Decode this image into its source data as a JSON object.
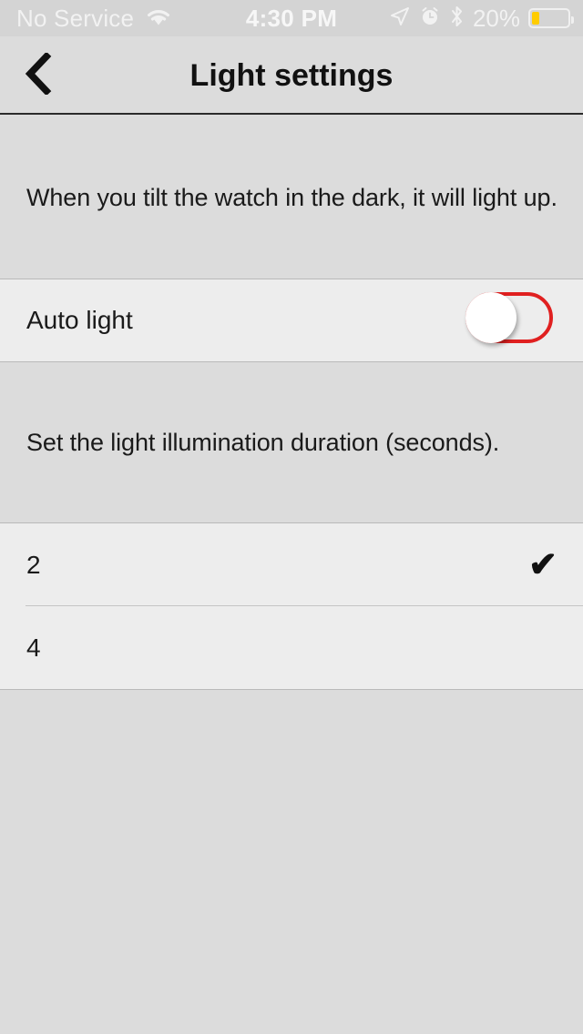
{
  "status_bar": {
    "carrier": "No Service",
    "wifi_icon": "wifi-icon",
    "time": "4:30 PM",
    "location_icon": "location-arrow-icon",
    "alarm_icon": "alarm-clock-icon",
    "bluetooth_icon": "bluetooth-icon",
    "battery_percent": "20%",
    "battery_level": 20,
    "battery_color": "#ffcc00"
  },
  "nav_bar": {
    "back_icon": "chevron-left-icon",
    "title": "Light settings"
  },
  "sections": {
    "auto_light": {
      "description": "When you tilt the watch in the dark, it will light up.",
      "row_label": "Auto light",
      "toggle_state": "off",
      "toggle_color": "#e02020"
    },
    "duration": {
      "description": "Set the light illumination duration (seconds).",
      "options": [
        {
          "label": "2",
          "selected": true
        },
        {
          "label": "4",
          "selected": false
        }
      ],
      "check_glyph": "✔"
    }
  },
  "colors": {
    "page_background": "#dcdcdc",
    "row_background": "#ededed",
    "accent": "#e02020"
  }
}
